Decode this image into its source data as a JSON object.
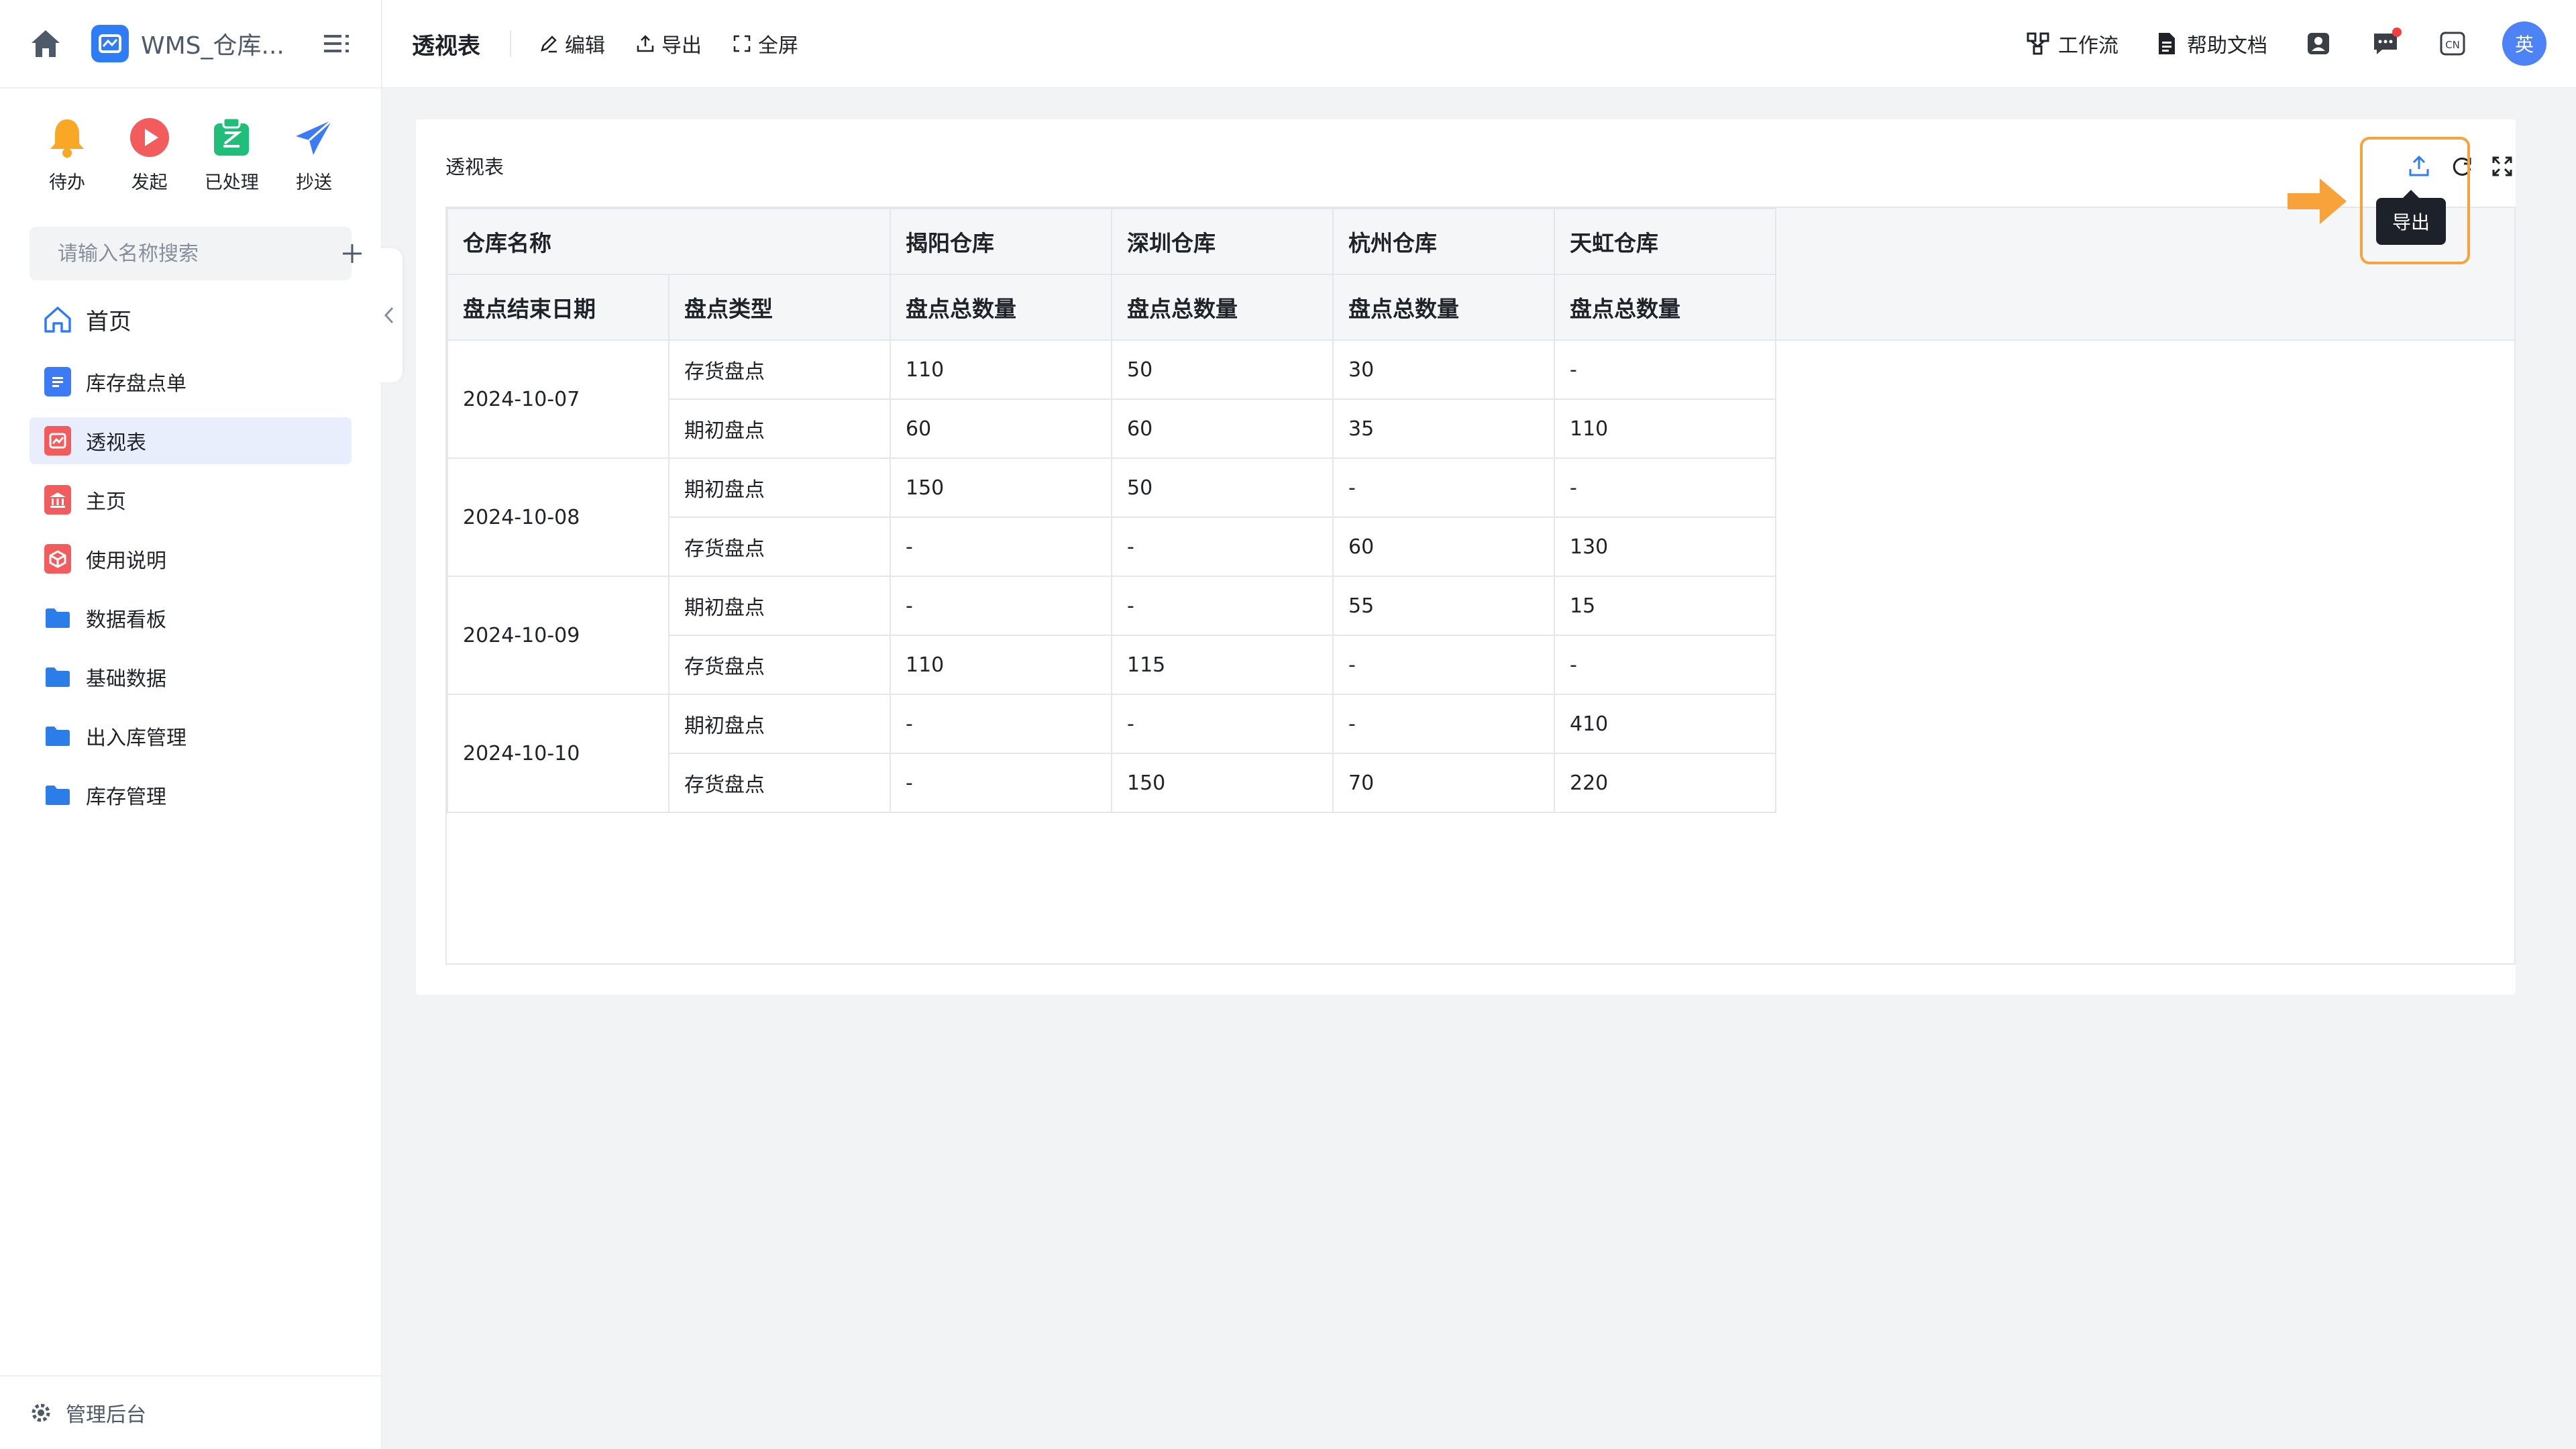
{
  "sidebar": {
    "app_name": "WMS_仓库...",
    "quick_actions": [
      {
        "label": "待办",
        "icon": "bell-icon",
        "color": "#f9a825"
      },
      {
        "label": "发起",
        "icon": "play-icon",
        "color": "#f25c5c"
      },
      {
        "label": "已处理",
        "icon": "approved-icon",
        "color": "#1fbf7a"
      },
      {
        "label": "抄送",
        "icon": "send-icon",
        "color": "#3b7cf6"
      }
    ],
    "search_placeholder": "请输入名称搜索",
    "nav": [
      {
        "label": "首页",
        "icon": "home-icon"
      },
      {
        "label": "库存盘点单",
        "icon": "form-icon",
        "color": "#3b7cf6"
      },
      {
        "label": "透视表",
        "icon": "pivot-icon",
        "color": "#f25c5c",
        "active": true
      },
      {
        "label": "主页",
        "icon": "bank-icon",
        "color": "#f25c5c"
      },
      {
        "label": "使用说明",
        "icon": "box-icon",
        "color": "#f25c5c"
      },
      {
        "label": "数据看板",
        "icon": "folder-icon",
        "color": "#2b7de9"
      },
      {
        "label": "基础数据",
        "icon": "folder-icon",
        "color": "#2b7de9"
      },
      {
        "label": "出入库管理",
        "icon": "folder-icon",
        "color": "#2b7de9"
      },
      {
        "label": "库存管理",
        "icon": "folder-icon",
        "color": "#2b7de9"
      }
    ],
    "footer_label": "管理后台"
  },
  "header": {
    "page_title": "透视表",
    "tools": [
      {
        "label": "编辑",
        "icon": "pencil-icon"
      },
      {
        "label": "导出",
        "icon": "export-icon"
      },
      {
        "label": "全屏",
        "icon": "fullscreen-icon"
      }
    ],
    "right": {
      "workflow": "工作流",
      "help": "帮助文档",
      "avatar_text": "英",
      "lang_icon_text": "CN"
    }
  },
  "card": {
    "title": "透视表",
    "tooltip": "导出",
    "accent": "#f7a23b"
  },
  "pivot": {
    "row_header_1": "仓库名称",
    "warehouses": [
      "揭阳仓库",
      "深圳仓库",
      "杭州仓库",
      "天虹仓库"
    ],
    "row_header_date": "盘点结束日期",
    "row_header_type": "盘点类型",
    "measure": "盘点总数量",
    "rows": [
      {
        "date": "2024-10-07",
        "items": [
          {
            "type": "存货盘点",
            "values": [
              "110",
              "50",
              "30",
              "-"
            ]
          },
          {
            "type": "期初盘点",
            "values": [
              "60",
              "60",
              "35",
              "110"
            ]
          }
        ]
      },
      {
        "date": "2024-10-08",
        "items": [
          {
            "type": "期初盘点",
            "values": [
              "150",
              "50",
              "-",
              "-"
            ]
          },
          {
            "type": "存货盘点",
            "values": [
              "-",
              "-",
              "60",
              "130"
            ]
          }
        ]
      },
      {
        "date": "2024-10-09",
        "items": [
          {
            "type": "期初盘点",
            "values": [
              "-",
              "-",
              "55",
              "15"
            ]
          },
          {
            "type": "存货盘点",
            "values": [
              "110",
              "115",
              "-",
              "-"
            ]
          }
        ]
      },
      {
        "date": "2024-10-10",
        "items": [
          {
            "type": "期初盘点",
            "values": [
              "-",
              "-",
              "-",
              "410"
            ]
          },
          {
            "type": "存货盘点",
            "values": [
              "-",
              "150",
              "70",
              "220"
            ]
          }
        ]
      }
    ]
  }
}
